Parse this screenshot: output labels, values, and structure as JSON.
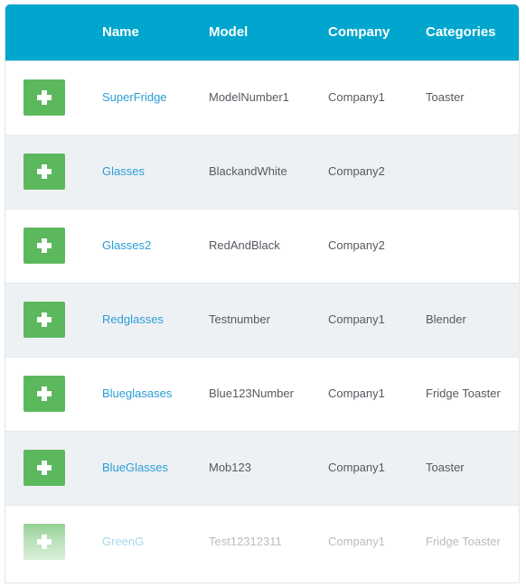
{
  "table": {
    "headers": {
      "name": "Name",
      "model": "Model",
      "company": "Company",
      "categories": "Categories"
    },
    "rows": [
      {
        "name": "SuperFridge",
        "model": "ModelNumber1",
        "company": "Company1",
        "categories": "Toaster"
      },
      {
        "name": "Glasses",
        "model": "BlackandWhite",
        "company": "Company2",
        "categories": ""
      },
      {
        "name": "Glasses2",
        "model": "RedAndBlack",
        "company": "Company2",
        "categories": ""
      },
      {
        "name": "Redglasses",
        "model": "Testnumber",
        "company": "Company1",
        "categories": "Blender"
      },
      {
        "name": "Blueglasases",
        "model": "Blue123Number",
        "company": "Company1",
        "categories": "Fridge Toaster"
      },
      {
        "name": "BlueGlasses",
        "model": "Mob123",
        "company": "Company1",
        "categories": "Toaster"
      },
      {
        "name": "GreenG",
        "model": "Test12312311",
        "company": "Company1",
        "categories": "Fridge Toaster"
      }
    ]
  },
  "icons": {
    "add_button": "plus-icon"
  },
  "colors": {
    "header_bg": "#00a6cd",
    "add_button": "#5cb85c",
    "link": "#2a9dd6",
    "alt_row_bg": "#eef1f4"
  }
}
